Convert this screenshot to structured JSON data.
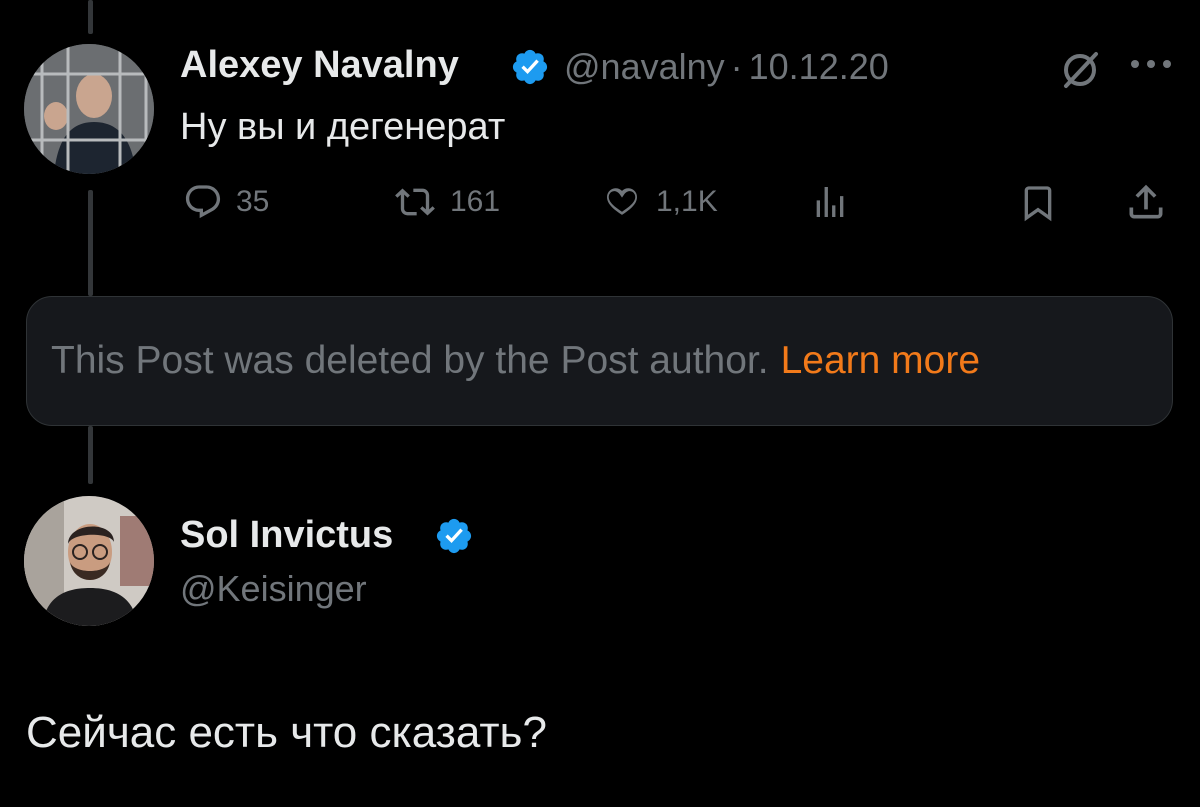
{
  "tweet": {
    "author_name": "Alexey Navalny",
    "handle": "@navalny",
    "separator": "·",
    "date": "10.12.20",
    "text": "Ну вы и дегенерат",
    "stats": {
      "replies": "35",
      "reposts": "161",
      "likes": "1,1K"
    }
  },
  "deleted_notice": {
    "message": "This Post was deleted by the Post author.",
    "link": "Learn more"
  },
  "reply": {
    "author_name": "Sol Invictus",
    "handle": "@Keisinger",
    "text": "Сейчас есть что сказать?"
  },
  "icons": {
    "verified": "verified-badge-icon",
    "grok": "grok-icon",
    "more": "more-icon",
    "reply": "reply-icon",
    "repost": "repost-icon",
    "like": "like-icon",
    "views": "views-icon",
    "bookmark": "bookmark-icon",
    "share": "share-icon"
  },
  "colors": {
    "background": "#000000",
    "text": "#e7e9ea",
    "muted": "#71767b",
    "verified": "#1d9bf0",
    "link": "#f27a1a",
    "notice_bg": "#16181c"
  }
}
